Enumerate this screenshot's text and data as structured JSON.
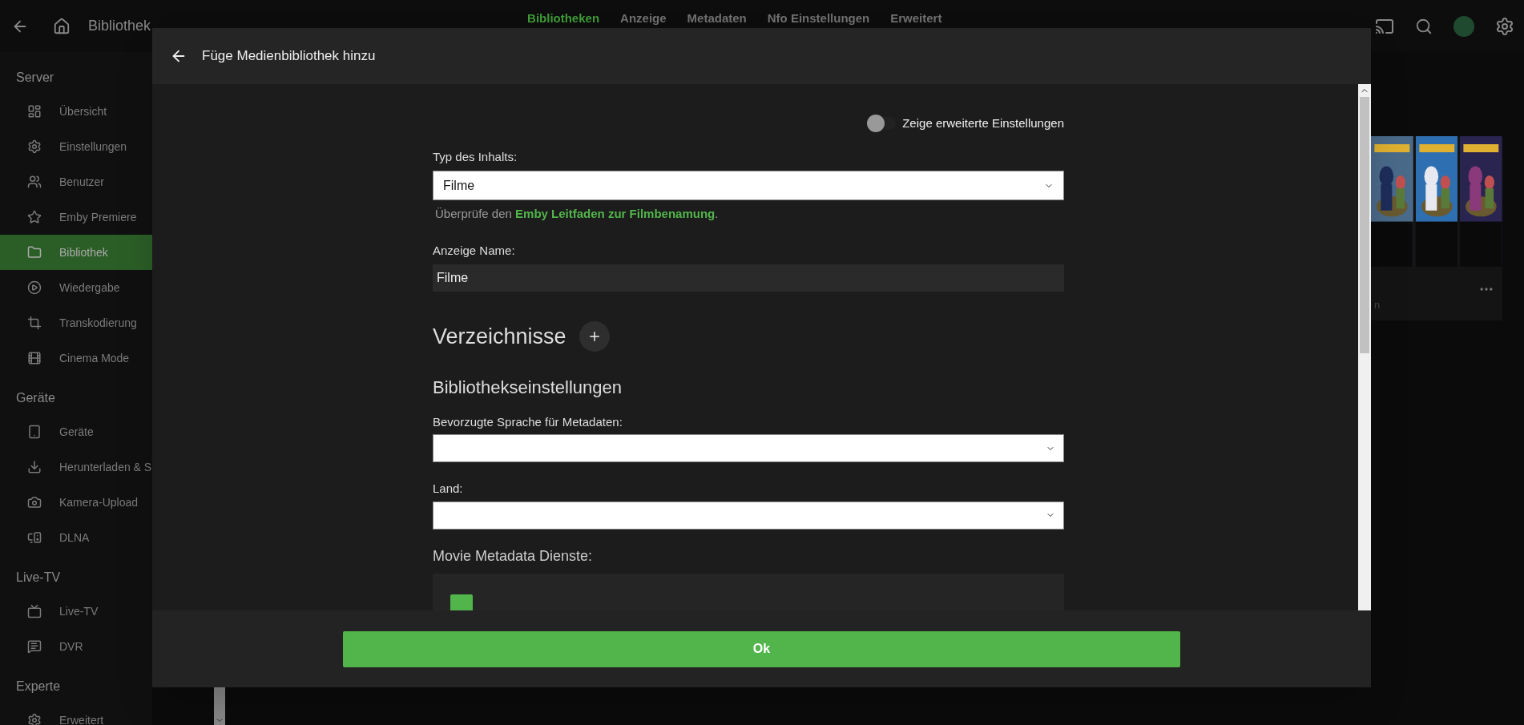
{
  "top_bar": {
    "title": "Bibliothek",
    "tabs": [
      {
        "label": "Bibliotheken",
        "selected": true
      },
      {
        "label": "Anzeige",
        "selected": false
      },
      {
        "label": "Metadaten",
        "selected": false
      },
      {
        "label": "Nfo Einstellungen",
        "selected": false
      },
      {
        "label": "Erweitert",
        "selected": false
      }
    ]
  },
  "sidebar": {
    "sections": [
      {
        "title": "Server",
        "items": [
          {
            "label": "Übersicht",
            "selected": false
          },
          {
            "label": "Einstellungen",
            "selected": false
          },
          {
            "label": "Benutzer",
            "selected": false
          },
          {
            "label": "Emby Premiere",
            "selected": false
          },
          {
            "label": "Bibliothek",
            "selected": true
          },
          {
            "label": "Wiedergabe",
            "selected": false
          },
          {
            "label": "Transkodierung",
            "selected": false
          },
          {
            "label": "Cinema Mode",
            "selected": false
          }
        ]
      },
      {
        "title": "Geräte",
        "items": [
          {
            "label": "Geräte",
            "selected": false
          },
          {
            "label": "Herunterladen & S",
            "selected": false
          },
          {
            "label": "Kamera-Upload",
            "selected": false
          },
          {
            "label": "DLNA",
            "selected": false
          }
        ]
      },
      {
        "title": "Live-TV",
        "items": [
          {
            "label": "Live-TV",
            "selected": false
          },
          {
            "label": "DVR",
            "selected": false
          }
        ]
      },
      {
        "title": "Experte",
        "items": [
          {
            "label": "Erweitert",
            "selected": false
          }
        ]
      }
    ]
  },
  "background_card": {
    "caption": "n"
  },
  "dialog": {
    "title": "Füge Medienbibliothek hinzu",
    "advanced_toggle": {
      "label": "Zeige erweiterte Einstellungen",
      "on": false
    },
    "content_type": {
      "label": "Typ des Inhalts:",
      "value": "Filme",
      "help_prefix": "Überprüfe den",
      "help_link": "Emby Leitfaden zur Filmbenamung",
      "help_suffix": "."
    },
    "display_name": {
      "label": "Anzeige Name:",
      "value": "Filme"
    },
    "directories_heading": "Verzeichnisse",
    "library_settings_heading": "Bibliothekseinstellungen",
    "metadata_language": {
      "label": "Bevorzugte Sprache für Metadaten:"
    },
    "country": {
      "label": "Land:"
    },
    "metadata_services": {
      "label": "Movie Metadata Dienste:",
      "first_checked": true
    },
    "ok_button": "Ok"
  }
}
